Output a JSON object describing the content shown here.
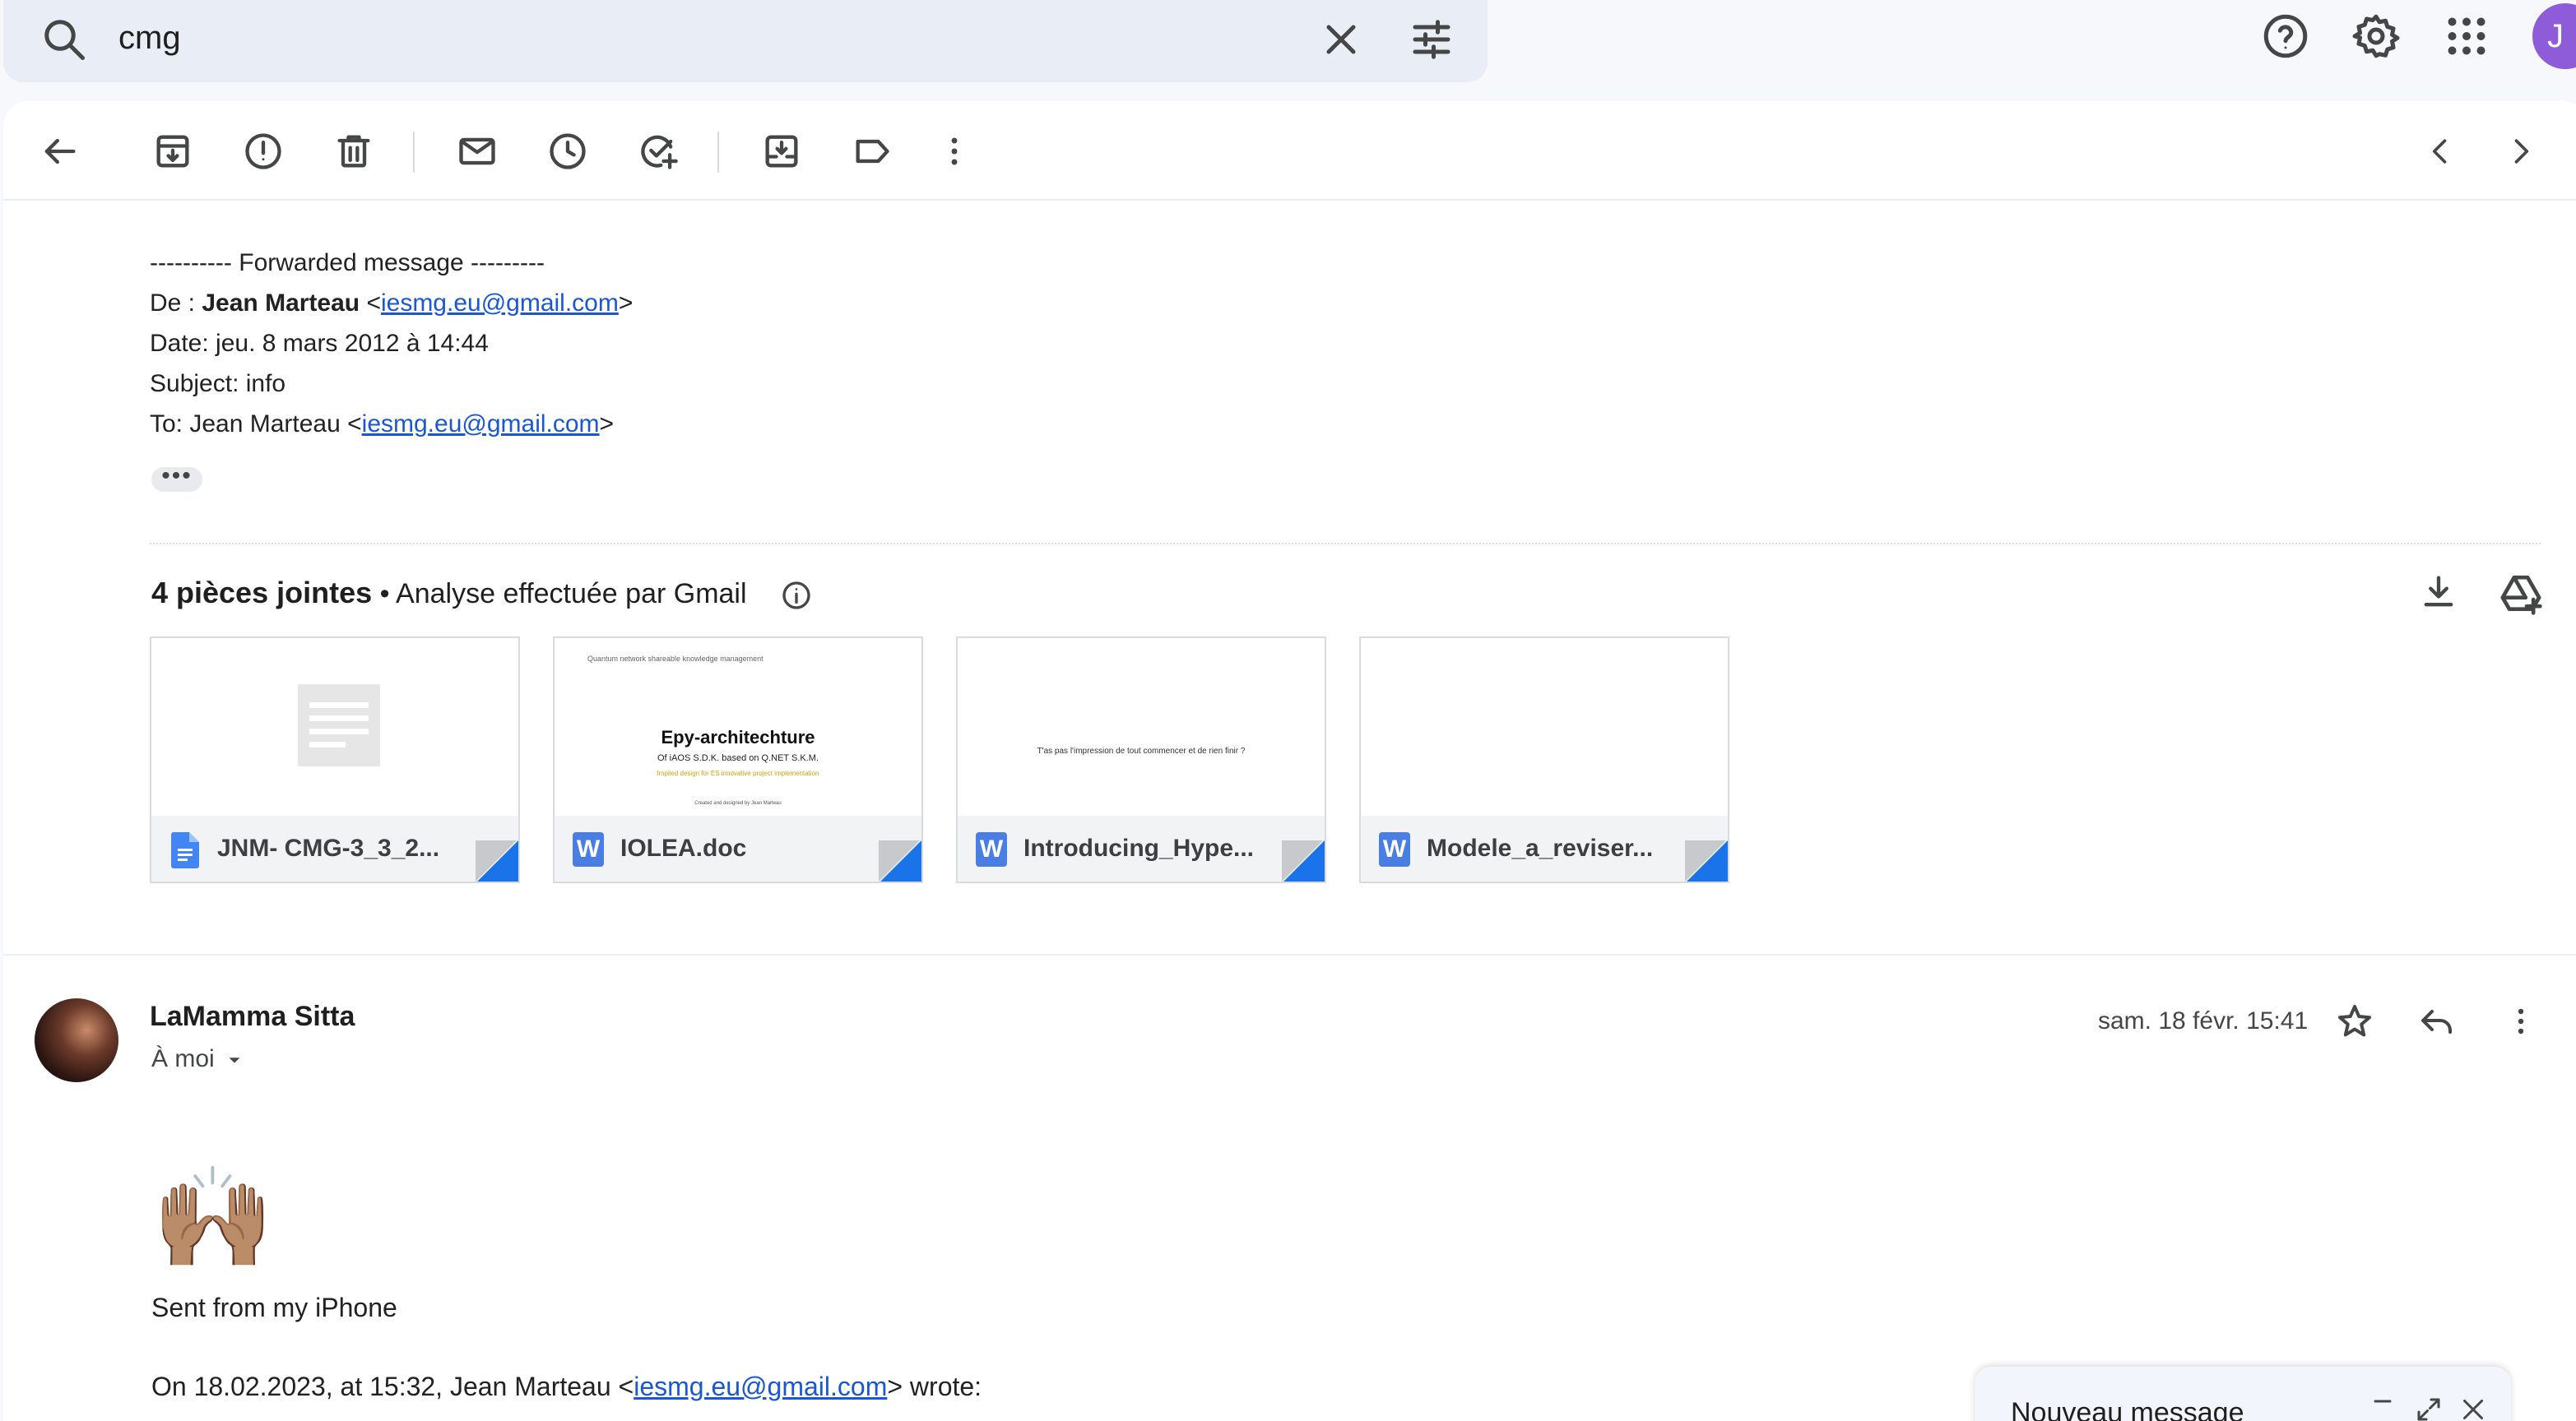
{
  "search": {
    "query": "cmg"
  },
  "header": {
    "avatar_letter": "J"
  },
  "forwarded": {
    "divider": "---------- Forwarded message ---------",
    "from_label": "De : ",
    "from_name": "Jean Marteau",
    "from_email": "iesmg.eu@gmail.com",
    "date": "Date: jeu. 8 mars 2012 à 14:44",
    "subject": "Subject: info",
    "to_label": "To: Jean Marteau <",
    "to_email": "iesmg.eu@gmail.com"
  },
  "attachments": {
    "count_label": "4 pièces jointes",
    "scan_label": " • Analyse effectuée par Gmail",
    "items": [
      {
        "name": "JNM- CMG-3_3_2...",
        "type": "gdoc"
      },
      {
        "name": "IOLEA.doc",
        "type": "word",
        "preview_top": "Quantum network shareable knowledge management",
        "preview_title": "Epy-architechture",
        "preview_sub": "Of iAOS S.D.K. based on Q.NET S.K.M.",
        "preview_note": "Implied design for ES innovative project implementation",
        "preview_footer": "Created and designed by Jean Marteau"
      },
      {
        "name": "Introducing_Hype...",
        "type": "word",
        "preview_line": "T'as pas l'impression de tout commencer et de rien finir ?"
      },
      {
        "name": "Modele_a_reviser...",
        "type": "word"
      }
    ]
  },
  "message": {
    "sender": "LaMamma Sitta",
    "recipient": "À moi",
    "date": "sam. 18 févr. 15:41",
    "emoji": "🙌🏽",
    "signature": "Sent from my iPhone",
    "quote_prefix": "On 18.02.2023, at 15:32, Jean Marteau <",
    "quote_email": "iesmg.eu@gmail.com",
    "quote_suffix": "> wrote:"
  },
  "compose": {
    "title": "Nouveau message"
  },
  "colors": {
    "accent": "#1a57d5",
    "word_icon": "#4a7ee3",
    "avatar": "#8e5cd9"
  }
}
